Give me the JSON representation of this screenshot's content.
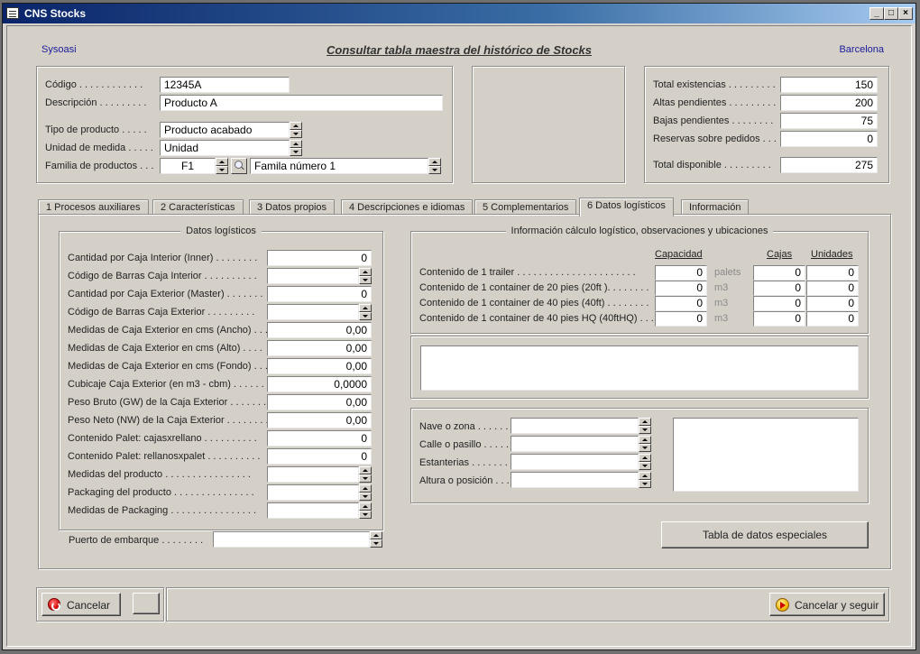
{
  "window": {
    "title": "CNS Stocks"
  },
  "header": {
    "company": "Sysoasi",
    "title": "Consultar tabla maestra del histórico de Stocks",
    "location": "Barcelona"
  },
  "product": {
    "codigo_label": "Código . . . . . . . . . . . .",
    "codigo": "12345A",
    "descripcion_label": "Descripción . . . . . . . . .",
    "descripcion": "Producto A",
    "tipo_label": "Tipo de producto . . . . .",
    "tipo": "Producto acabado",
    "unidad_label": "Unidad de medida . . . . .",
    "unidad": "Unidad",
    "familia_label": "Familia de productos . . .",
    "familia_code": "F1",
    "familia_name": "Famila número 1"
  },
  "totals": {
    "existencias_label": "Total existencias . . . . . . . . .",
    "existencias": "150",
    "altas_label": "Altas pendientes . . . . . . . . .",
    "altas": "200",
    "bajas_label": "Bajas pendientes . . . . . . . .",
    "bajas": "75",
    "reservas_label": "Reservas sobre pedidos . . .",
    "reservas": "0",
    "disponible_label": "Total disponible . . . . . . . . .",
    "disponible": "275"
  },
  "tabs": [
    "1  Procesos auxiliares",
    "2  Características",
    "3  Datos propios",
    "4  Descripciones e idiomas",
    "5  Complementarios",
    "6  Datos logísticos",
    "Información"
  ],
  "logistics": {
    "title": "Datos logísticos",
    "rows": [
      {
        "label": "Cantidad por Caja Interior (Inner) . . . . . . . .",
        "value": "0",
        "spin": false
      },
      {
        "label": "Código de Barras Caja Interior . . . . . . . . . .",
        "value": "",
        "spin": true
      },
      {
        "label": "Cantidad por Caja Exterior (Master) . . . . . . .",
        "value": "0",
        "spin": false
      },
      {
        "label": "Código de Barras Caja Exterior . . . . . . . . .",
        "value": "",
        "spin": true
      },
      {
        "label": "Medidas de Caja Exterior en cms (Ancho) . . .",
        "value": "0,00",
        "spin": false
      },
      {
        "label": "Medidas de Caja Exterior en cms (Alto) . . . .",
        "value": "0,00",
        "spin": false
      },
      {
        "label": "Medidas de Caja Exterior en cms (Fondo) . . .",
        "value": "0,00",
        "spin": false
      },
      {
        "label": "Cubicaje Caja Exterior (en m3 - cbm) . . . . . .",
        "value": "0,0000",
        "spin": false
      },
      {
        "label": "Peso Bruto (GW) de la Caja Exterior . . . . . . .",
        "value": "0,00",
        "spin": false
      },
      {
        "label": "Peso Neto (NW) de la Caja Exterior . . . . . . . .",
        "value": "0,00",
        "spin": false
      },
      {
        "label": "Contenido Palet: cajasxrellano . . . . . . . . . .",
        "value": "0",
        "spin": false
      },
      {
        "label": "Contenido Palet: rellanosxpalet . . . . . . . . . .",
        "value": "0",
        "spin": false
      },
      {
        "label": "Medidas del producto . . . . . . . . . . . . . . . .",
        "value": "",
        "spin": true
      },
      {
        "label": "Packaging del producto . . . . . . . . . . . . . . .",
        "value": "",
        "spin": true
      },
      {
        "label": "Medidas de Packaging . . . . . . . . . . . . . . . .",
        "value": "",
        "spin": true
      }
    ],
    "puerto_label": "Puerto de embarque . . . . . . . .",
    "puerto": ""
  },
  "calc": {
    "title": "Información cálculo logístico, observaciones y ubicaciones",
    "col_capacidad": "Capacidad",
    "col_cajas": "Cajas",
    "col_unidades": "Unidades",
    "rows": [
      {
        "label": "Contenido de 1 trailer . . . . . . . . . . . . . . . . . . . . . .",
        "capacidad": "0",
        "unit": "palets",
        "cajas": "0",
        "unidades": "0"
      },
      {
        "label": "Contenido de 1 container de 20 pies (20ft ). . . . . . . .",
        "capacidad": "0",
        "unit": "m3",
        "cajas": "0",
        "unidades": "0"
      },
      {
        "label": "Contenido de 1 container de 40 pies (40ft) . . . . . . . .",
        "capacidad": "0",
        "unit": "m3",
        "cajas": "0",
        "unidades": "0"
      },
      {
        "label": "Contenido de 1 container de 40 pies HQ (40ftHQ) . . . .",
        "capacidad": "0",
        "unit": "m3",
        "cajas": "0",
        "unidades": "0"
      }
    ]
  },
  "location": {
    "nave_label": "Nave o zona . . . . . .",
    "nave": "",
    "calle_label": "Calle o pasillo . . . . .",
    "calle": "",
    "estanterias_label": "Estanterias . . . . . . .",
    "estanterias": "",
    "altura_label": "Altura o posición . . .",
    "altura": ""
  },
  "buttons": {
    "tabla": "Tabla de datos especiales",
    "cancelar": "Cancelar",
    "cancelar_seguir": "Cancelar y seguir"
  }
}
